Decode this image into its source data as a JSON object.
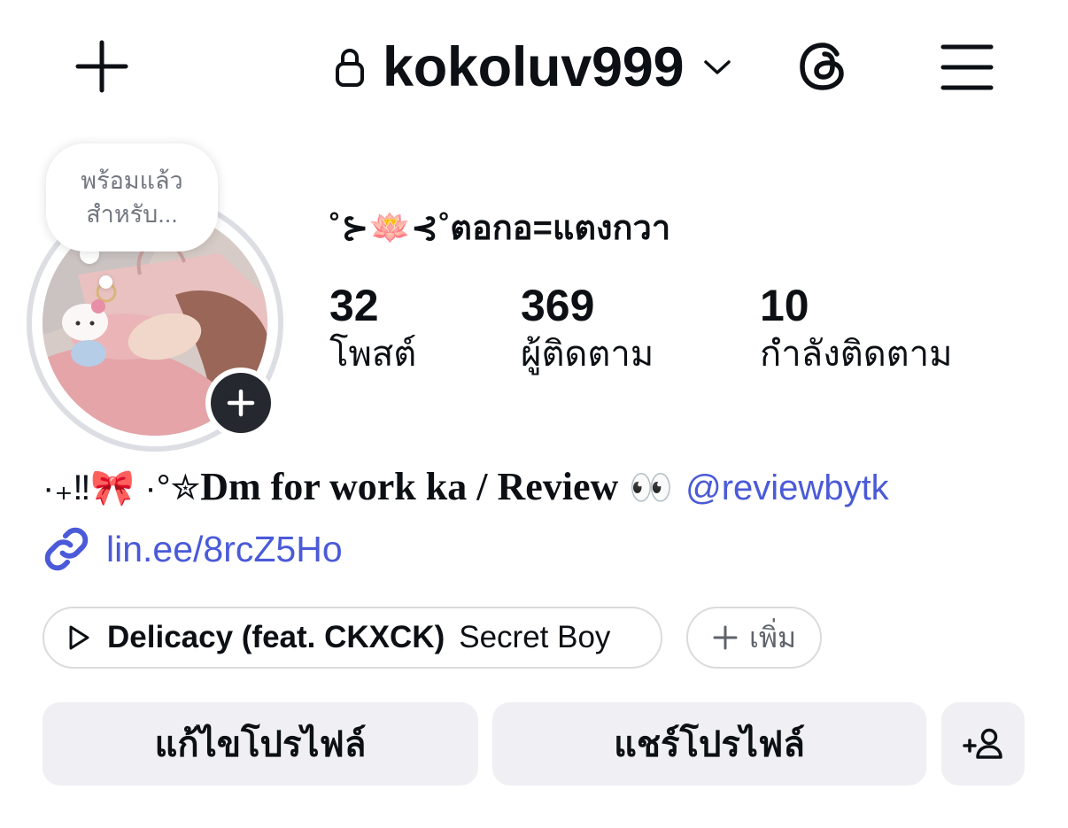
{
  "header": {
    "username": "kokoluv999",
    "icons": {
      "create": "plus-icon",
      "private_account": "lock-icon",
      "account_switcher": "chevron-down-icon",
      "threads": "threads-icon",
      "menu": "hamburger-menu-icon"
    }
  },
  "profile": {
    "note": {
      "line1": "พร้อมแล้ว",
      "line2": "สำหรับ..."
    },
    "add_story_icon": "plus-icon",
    "display_name": "˚⊱🪷⊰˚ตอกอ=แตงกวา",
    "stats": [
      {
        "value": "32",
        "label": "โพสต์"
      },
      {
        "value": "369",
        "label": "ผู้ติดตาม"
      },
      {
        "value": "10",
        "label": "กำลังติดตาม"
      }
    ],
    "bio": {
      "prefix": "·₊‼🎀 ·°✮",
      "text": "Dm for work ka / Review",
      "emoji": "👀",
      "mention": "@reviewbytk"
    },
    "link": {
      "icon": "link-icon",
      "text": "lin.ee/8rcZ5Ho"
    },
    "music": {
      "icon": "play-icon",
      "title": "Delicacy (feat. CKXCK)",
      "artist": "Secret Boy"
    },
    "add_chip": {
      "icon": "plus-icon",
      "label": "เพิ่ม"
    }
  },
  "actions": {
    "edit_profile": "แก้ไขโปรไฟล์",
    "share_profile": "แชร์โปรไฟล์",
    "add_person_icon": "add-person-icon"
  },
  "colors": {
    "text": "#0c1014",
    "link": "#4a5ad8",
    "button_bg": "#efeff4",
    "muted": "#737780",
    "ring": "#dcdee3",
    "badge": "#25282e",
    "chip_border": "#dbdbdb",
    "chip_muted": "#5f636b"
  }
}
